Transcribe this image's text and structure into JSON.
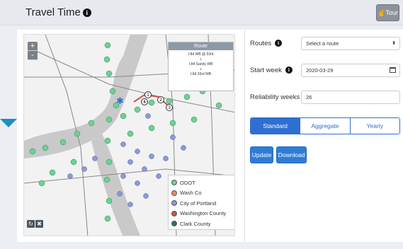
{
  "header": {
    "title": "Travel Time",
    "info_icon": "info-circle-icon",
    "tour_label": "Tour",
    "tour_icon": "hand-pointer-icon"
  },
  "map": {
    "zoom_in": "+",
    "zoom_out": "-",
    "route_box": {
      "title": "Route",
      "from": "I-84 WB @ 53rd",
      "arrow": "🡣",
      "mid": "I-84 Sandy WB",
      "arrow2": "🡣",
      "to": "I-84 33rd WB"
    },
    "markers": [
      "1",
      "2",
      "3",
      "4"
    ],
    "legend": [
      {
        "label": "ODOT",
        "color": "#6fcf97"
      },
      {
        "label": "Wash Co",
        "color": "#f08a62"
      },
      {
        "label": "City of Portland",
        "color": "#8d99d6"
      },
      {
        "label": "Washington County",
        "color": "#c7564e"
      },
      {
        "label": "Clark County",
        "color": "#2f6f64"
      }
    ],
    "controls": {
      "reset": "↻",
      "clear": "✖"
    }
  },
  "form": {
    "routes_label": "Routes",
    "routes_value": "Select a route",
    "start_week_label": "Start week",
    "start_week_value": "2020-03-29",
    "reliability_label": "Reliability weeks",
    "reliability_value": "26",
    "tabs": [
      "Standard",
      "Aggregate",
      "Yearly"
    ],
    "update_label": "Update",
    "download_label": "Download"
  },
  "colors": {
    "accent": "#2f7cd8",
    "odot": "#6fcf97",
    "portland": "#8d99d6"
  }
}
